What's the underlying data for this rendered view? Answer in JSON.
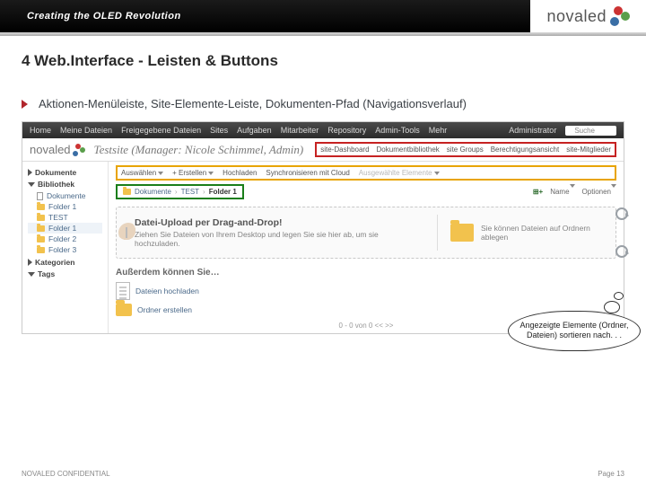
{
  "banner": {
    "tagline": "Creating the OLED Revolution",
    "brand": "novaled"
  },
  "slide": {
    "title": "4 Web.Interface - Leisten & Buttons",
    "bullet": "Aktionen-Menüleiste, Site-Elemente-Leiste, Dokumenten-Pfad (Navigationsverlauf)"
  },
  "app": {
    "topnav": {
      "items": [
        "Home",
        "Meine Dateien",
        "Freigegebene Dateien",
        "Sites",
        "Aufgaben",
        "Mitarbeiter",
        "Repository",
        "Admin-Tools"
      ],
      "more": "Mehr",
      "user": "Administrator",
      "search_placeholder": "Suche"
    },
    "site": {
      "name": "Testsite (Manager: Nicole Schimmel, Admin)",
      "tabs": [
        "site-Dashboard",
        "Dokumentbibliothek",
        "site Groups",
        "Berechtigungsansicht",
        "site-Mitglieder"
      ]
    },
    "sidebar": {
      "sec_docs": "Dokumente",
      "sec_lib": "Bibliothek",
      "doc_label": "Dokumente",
      "items": [
        "Folder 1",
        "TEST",
        "Folder 1",
        "Folder 2",
        "Folder 3"
      ],
      "sec_cat": "Kategorien",
      "sec_tags": "Tags"
    },
    "actions": {
      "a0": "Auswählen",
      "a1": "+ Erstellen",
      "a2": "Hochladen",
      "a3": "Synchronisieren mit Cloud",
      "a4": "Ausgewählte Elemente"
    },
    "crumb": {
      "c0": "Dokumente",
      "c1": "TEST",
      "c2": "Folder 1"
    },
    "viewbar": {
      "sort": "Name",
      "options": "Optionen"
    },
    "drag": {
      "title": "Datei-Upload per Drag-and-Drop!",
      "sub": "Ziehen Sie Dateien von Ihrem Desktop und legen Sie sie hier ab, um sie hochzuladen.",
      "right": "Sie können Dateien auf Ordnern ablegen"
    },
    "also": {
      "title": "Außerdem können Sie…",
      "row1": "Dateien hochladen",
      "row2": "Ordner erstellen",
      "paging": "0 - 0 von 0   <<   >>"
    }
  },
  "callout": "Angezeigte Elemente (Ordner, Dateien) sortieren nach. . .",
  "footer": {
    "left": "NOVALED CONFIDENTIAL",
    "right": "Page 13"
  }
}
